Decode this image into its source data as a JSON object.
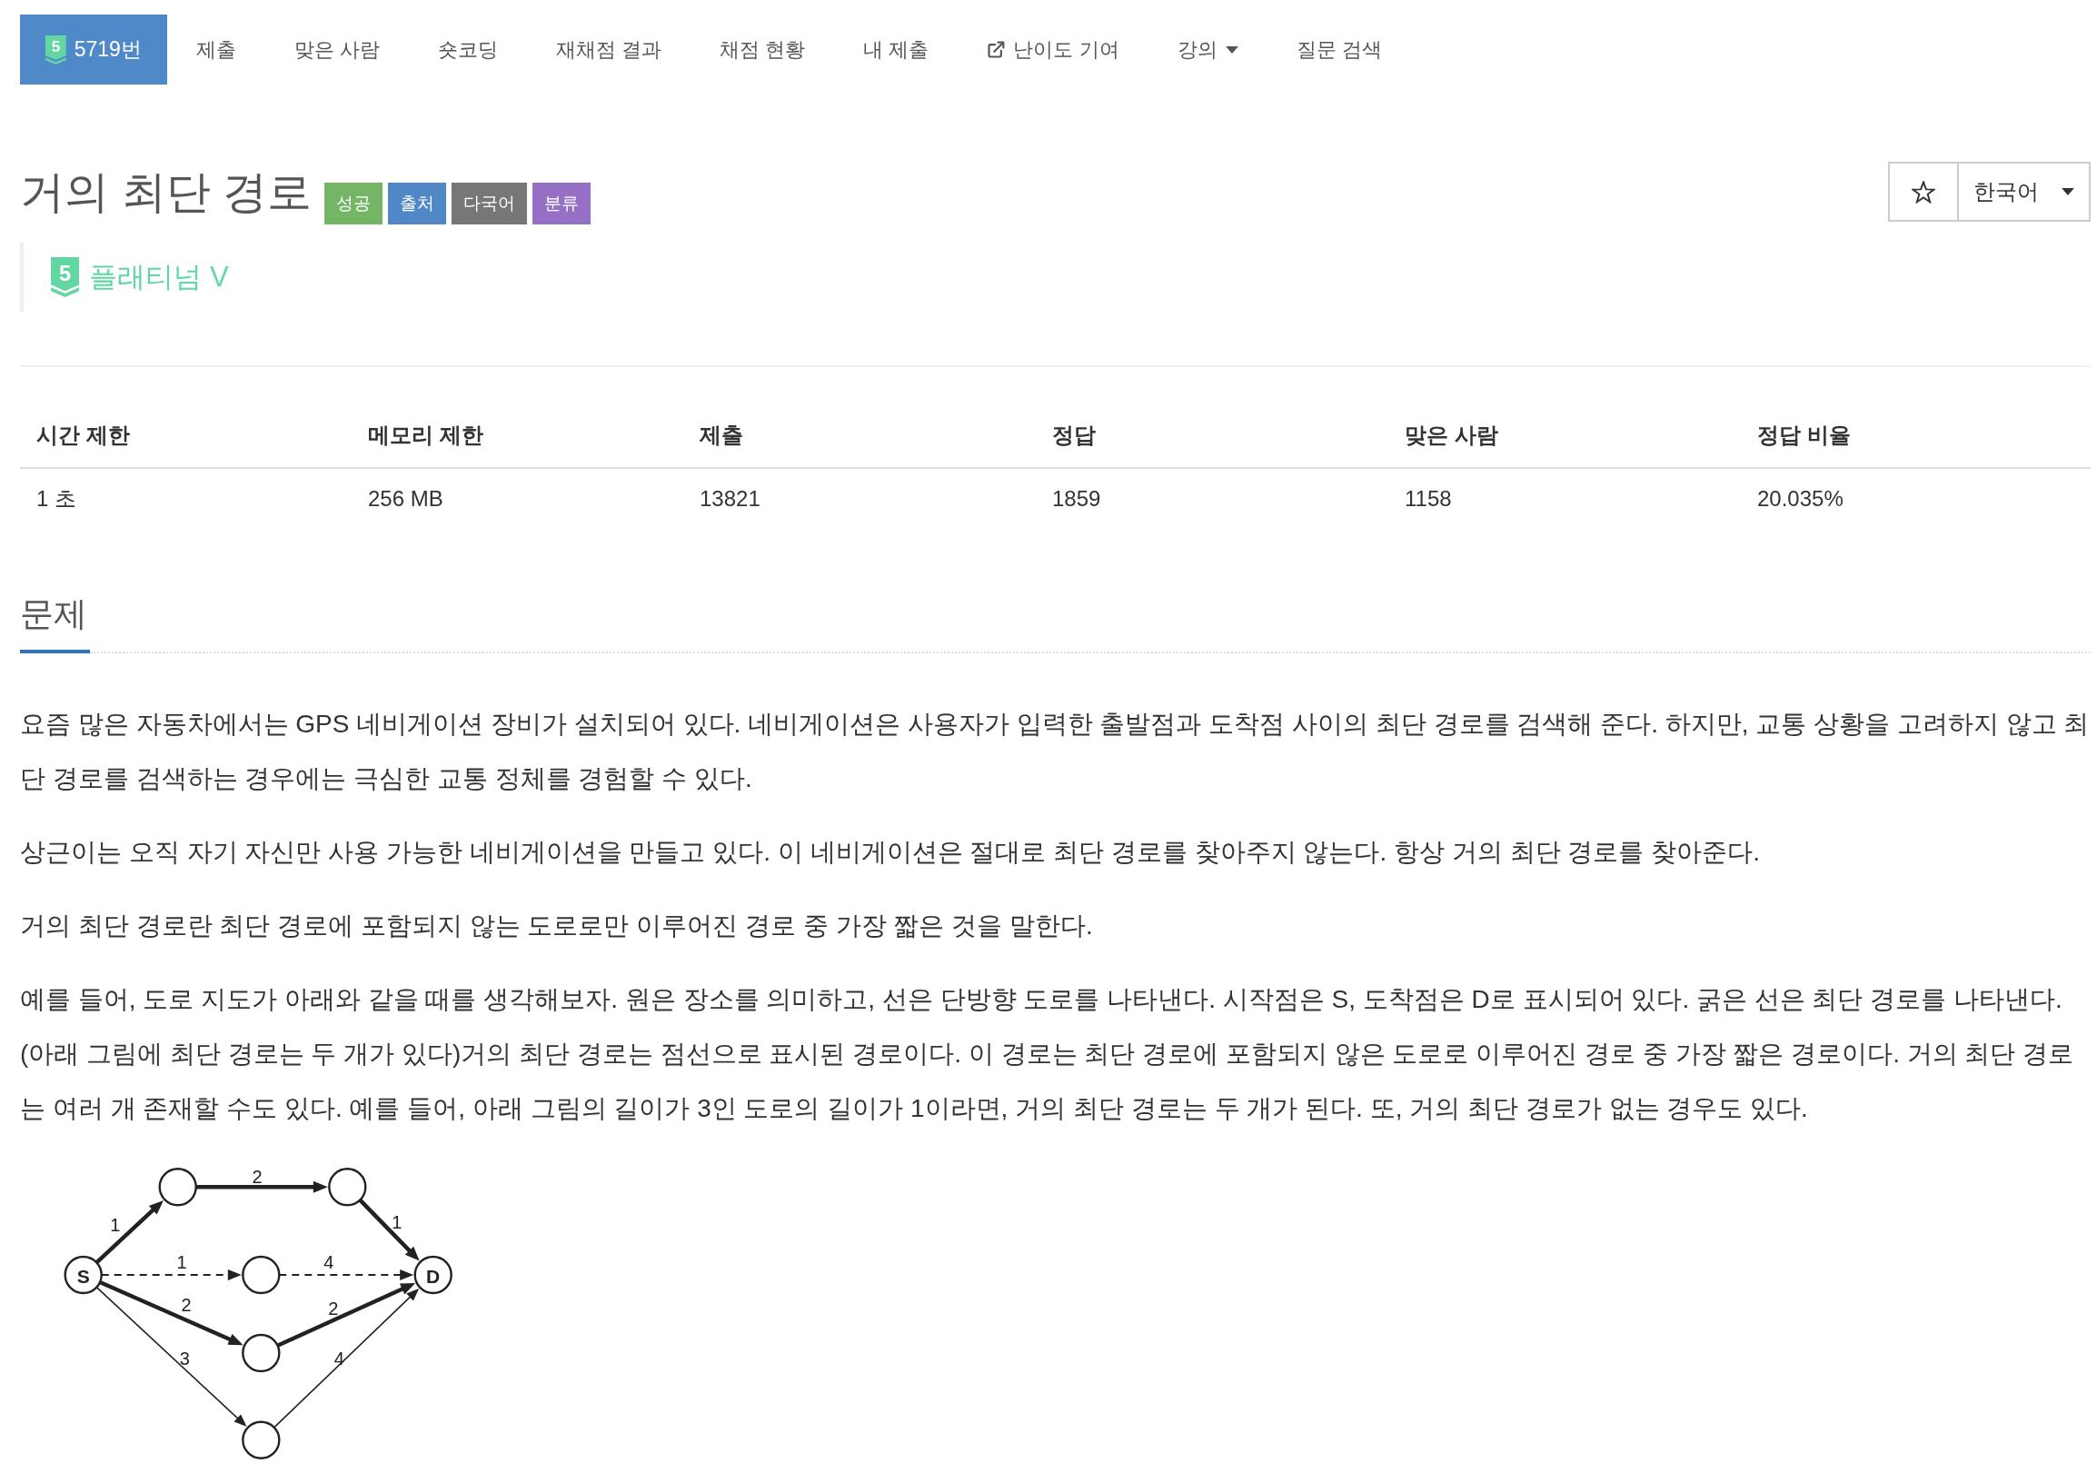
{
  "tabs": [
    {
      "label": "5719번",
      "tier_digit": "5",
      "kind": "problem",
      "selected": true
    },
    {
      "label": "제출",
      "kind": "link",
      "selected": false
    },
    {
      "label": "맞은 사람",
      "kind": "link",
      "selected": false
    },
    {
      "label": "숏코딩",
      "kind": "link",
      "selected": false
    },
    {
      "label": "재채점 결과",
      "kind": "link",
      "selected": false
    },
    {
      "label": "채점 현황",
      "kind": "link",
      "selected": false
    },
    {
      "label": "내 제출",
      "kind": "link",
      "selected": false
    },
    {
      "label": "난이도 기여",
      "kind": "external",
      "selected": false
    },
    {
      "label": "강의",
      "kind": "dropdown",
      "selected": false
    },
    {
      "label": "질문 검색",
      "kind": "link",
      "selected": false
    }
  ],
  "title": "거의 최단 경로",
  "tags": [
    {
      "label": "성공",
      "color": "#74b566"
    },
    {
      "label": "출처",
      "color": "#5088c7"
    },
    {
      "label": "다국어",
      "color": "#777777"
    },
    {
      "label": "분류",
      "color": "#9570c5"
    }
  ],
  "language_select": {
    "value": "한국어"
  },
  "tier": {
    "digit": "5",
    "name": "플래티넘 V"
  },
  "stats": {
    "columns": [
      "시간 제한",
      "메모리 제한",
      "제출",
      "정답",
      "맞은 사람",
      "정답 비율"
    ],
    "rows": [
      [
        "1 초",
        "256 MB",
        "13821",
        "1859",
        "1158",
        "20.035%"
      ]
    ]
  },
  "section": {
    "title": "문제",
    "paragraphs": [
      "요즘 많은 자동차에서는 GPS 네비게이션 장비가 설치되어 있다. 네비게이션은 사용자가 입력한 출발점과 도착점 사이의 최단 경로를 검색해 준다. 하지만, 교통 상황을 고려하지 않고 최단 경로를 검색하는 경우에는 극심한 교통 정체를 경험할 수 있다.",
      "상근이는 오직 자기 자신만 사용 가능한 네비게이션을 만들고 있다. 이 네비게이션은 절대로 최단 경로를 찾아주지 않는다. 항상 거의 최단 경로를 찾아준다.",
      "거의 최단 경로란 최단 경로에 포함되지 않는 도로로만 이루어진 경로 중 가장 짧은 것을 말한다.",
      "예를 들어, 도로 지도가 아래와 같을 때를 생각해보자. 원은 장소를 의미하고, 선은 단방향 도로를 나타낸다. 시작점은 S, 도착점은 D로 표시되어 있다. 굵은 선은 최단 경로를 나타낸다. (아래 그림에 최단 경로는 두 개가 있다)거의 최단 경로는 점선으로 표시된 경로이다. 이 경로는 최단 경로에 포함되지 않은 도로로 이루어진 경로 중 가장 짧은 경로이다. 거의 최단 경로는 여러 개 존재할 수도 있다. 예를 들어, 아래 그림의 길이가 3인 도로의 길이가 1이라면, 거의 최단 경로는 두 개가 된다. 또, 거의 최단 경로가 없는 경우도 있다."
    ]
  },
  "figure": {
    "start_node": "S",
    "end_node": "D",
    "edges": [
      {
        "kind": "bold",
        "weight": "1"
      },
      {
        "kind": "bold",
        "weight": "2"
      },
      {
        "kind": "bold",
        "weight": "1"
      },
      {
        "kind": "dashed",
        "weight": "1"
      },
      {
        "kind": "dashed",
        "weight": "4"
      },
      {
        "kind": "bold",
        "weight": "2"
      },
      {
        "kind": "bold",
        "weight": "2"
      },
      {
        "kind": "thin",
        "weight": "3"
      },
      {
        "kind": "thin",
        "weight": "4"
      }
    ]
  }
}
